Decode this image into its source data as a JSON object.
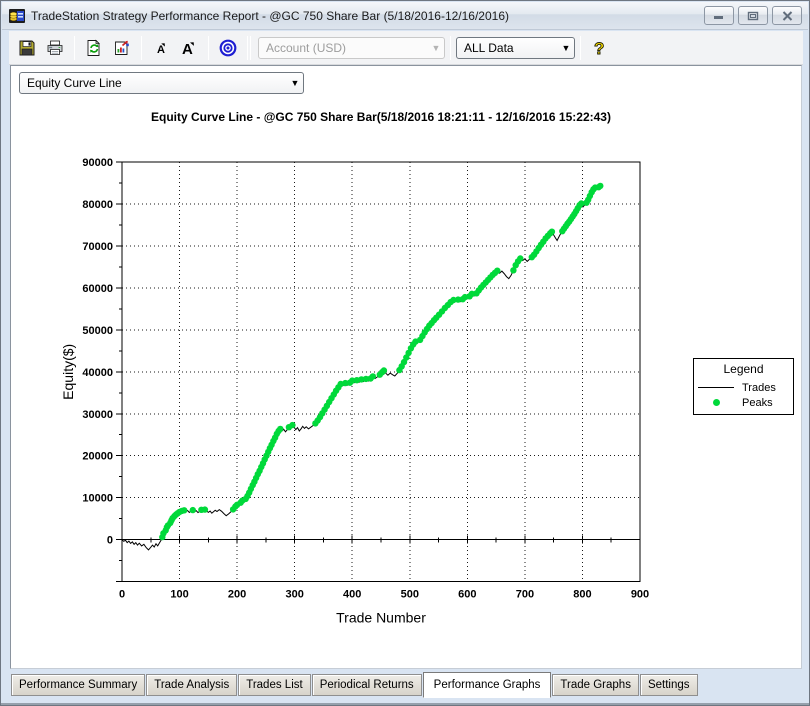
{
  "window": {
    "title": "TradeStation Strategy Performance Report - @GC 750 Share Bar (5/18/2016-12/16/2016)"
  },
  "toolbar": {
    "buttons": [
      "save",
      "print",
      "refresh-report",
      "export-report",
      "font-decrease",
      "font-increase",
      "target"
    ],
    "account_combo": {
      "value": "Account (USD)",
      "disabled": true
    },
    "data_combo": {
      "value": "ALL Data",
      "disabled": false
    },
    "help": "help"
  },
  "report": {
    "graph_selector": {
      "value": "Equity Curve Line"
    },
    "chart_title": "Equity Curve Line - @GC 750 Share Bar(5/18/2016 18:21:11 - 12/16/2016 15:22:43)"
  },
  "legend": {
    "title": "Legend",
    "entries": [
      {
        "label": "Trades",
        "marker": "line",
        "color": "#000000"
      },
      {
        "label": "Peaks",
        "marker": "dot",
        "color": "#00d93a"
      }
    ]
  },
  "tabs": {
    "active": "Performance Graphs",
    "items": [
      "Performance Summary",
      "Trade Analysis",
      "Trades List",
      "Periodical Returns",
      "Performance Graphs",
      "Trade Graphs",
      "Settings"
    ]
  },
  "chart_data": {
    "type": "line",
    "title": "Equity Curve Line - @GC 750 Share Bar(5/18/2016 18:21:11 - 12/16/2016 15:22:43)",
    "xlabel": "Trade Number",
    "ylabel": "Equity($)",
    "xlim": [
      0,
      900
    ],
    "ylim": [
      -10000,
      90000
    ],
    "xtick_step": 100,
    "ytick_step": 10000,
    "grid": "dotted",
    "legend_position": "right",
    "series": [
      {
        "name": "Trades",
        "type": "line",
        "color": "#000000",
        "points": [
          [
            0,
            0
          ],
          [
            3,
            -400
          ],
          [
            6,
            -150
          ],
          [
            9,
            -700
          ],
          [
            12,
            -350
          ],
          [
            15,
            -900
          ],
          [
            18,
            -550
          ],
          [
            21,
            -1100
          ],
          [
            24,
            -700
          ],
          [
            27,
            -1300
          ],
          [
            30,
            -850
          ],
          [
            34,
            -1500
          ],
          [
            38,
            -1100
          ],
          [
            42,
            -1900
          ],
          [
            46,
            -2450
          ],
          [
            50,
            -1800
          ],
          [
            53,
            -1300
          ],
          [
            56,
            -1750
          ],
          [
            59,
            -1000
          ],
          [
            62,
            -1500
          ],
          [
            65,
            -800
          ],
          [
            68,
            -100
          ],
          [
            70,
            600
          ],
          [
            72,
            1500
          ],
          [
            74,
            1200
          ],
          [
            76,
            2200
          ],
          [
            78,
            3000
          ],
          [
            80,
            3400
          ],
          [
            82,
            3100
          ],
          [
            84,
            4000
          ],
          [
            86,
            4600
          ],
          [
            88,
            5100
          ],
          [
            91,
            5600
          ],
          [
            94,
            6000
          ],
          [
            97,
            6300
          ],
          [
            100,
            6600
          ],
          [
            104,
            6850
          ],
          [
            108,
            7000
          ],
          [
            111,
            6700
          ],
          [
            114,
            6950
          ],
          [
            117,
            6500
          ],
          [
            120,
            6800
          ],
          [
            123,
            7050
          ],
          [
            126,
            6600
          ],
          [
            129,
            6900
          ],
          [
            132,
            6450
          ],
          [
            135,
            6750
          ],
          [
            138,
            7100
          ],
          [
            141,
            6800
          ],
          [
            144,
            7150
          ],
          [
            147,
            6850
          ],
          [
            150,
            6500
          ],
          [
            153,
            6800
          ],
          [
            156,
            6300
          ],
          [
            159,
            6650
          ],
          [
            162,
            7000
          ],
          [
            165,
            6700
          ],
          [
            169,
            7150
          ],
          [
            173,
            6750
          ],
          [
            177,
            6200
          ],
          [
            181,
            5700
          ],
          [
            185,
            6100
          ],
          [
            189,
            6600
          ],
          [
            193,
            7200
          ],
          [
            197,
            7900
          ],
          [
            200,
            8300
          ],
          [
            203,
            8100
          ],
          [
            206,
            8800
          ],
          [
            209,
            9300
          ],
          [
            212,
            9100
          ],
          [
            215,
            9700
          ],
          [
            218,
            10400
          ],
          [
            221,
            11200
          ],
          [
            224,
            12100
          ],
          [
            227,
            13000
          ],
          [
            230,
            13800
          ],
          [
            233,
            14700
          ],
          [
            236,
            15600
          ],
          [
            239,
            16400
          ],
          [
            242,
            17300
          ],
          [
            245,
            18200
          ],
          [
            248,
            19100
          ],
          [
            251,
            20000
          ],
          [
            254,
            20900
          ],
          [
            257,
            21800
          ],
          [
            260,
            22600
          ],
          [
            263,
            23500
          ],
          [
            266,
            24300
          ],
          [
            269,
            25200
          ],
          [
            272,
            25900
          ],
          [
            275,
            26400
          ],
          [
            278,
            25900
          ],
          [
            281,
            26300
          ],
          [
            284,
            25700
          ],
          [
            287,
            26200
          ],
          [
            290,
            26800
          ],
          [
            293,
            26300
          ],
          [
            296,
            27300
          ],
          [
            299,
            26800
          ],
          [
            302,
            26200
          ],
          [
            305,
            26700
          ],
          [
            308,
            25900
          ],
          [
            311,
            26400
          ],
          [
            314,
            27000
          ],
          [
            317,
            26500
          ],
          [
            320,
            26900
          ],
          [
            324,
            26400
          ],
          [
            328,
            26800
          ],
          [
            332,
            27200
          ],
          [
            336,
            27700
          ],
          [
            340,
            28400
          ],
          [
            344,
            29200
          ],
          [
            348,
            30100
          ],
          [
            352,
            31000
          ],
          [
            356,
            31900
          ],
          [
            360,
            32800
          ],
          [
            364,
            33700
          ],
          [
            368,
            34600
          ],
          [
            372,
            35500
          ],
          [
            376,
            36300
          ],
          [
            380,
            37100
          ],
          [
            384,
            36700
          ],
          [
            388,
            37300
          ],
          [
            392,
            36800
          ],
          [
            396,
            37400
          ],
          [
            400,
            37900
          ],
          [
            404,
            37400
          ],
          [
            408,
            38000
          ],
          [
            412,
            37500
          ],
          [
            416,
            38200
          ],
          [
            420,
            37700
          ],
          [
            424,
            38300
          ],
          [
            428,
            37800
          ],
          [
            432,
            38400
          ],
          [
            436,
            38900
          ],
          [
            440,
            38400
          ],
          [
            444,
            38800
          ],
          [
            448,
            39300
          ],
          [
            452,
            39900
          ],
          [
            455,
            40300
          ],
          [
            458,
            39700
          ],
          [
            462,
            39200
          ],
          [
            466,
            39700
          ],
          [
            470,
            39300
          ],
          [
            474,
            39000
          ],
          [
            478,
            39600
          ],
          [
            482,
            40400
          ],
          [
            486,
            41300
          ],
          [
            490,
            42300
          ],
          [
            494,
            43400
          ],
          [
            498,
            44500
          ],
          [
            502,
            45600
          ],
          [
            506,
            46500
          ],
          [
            510,
            47200
          ],
          [
            514,
            46900
          ],
          [
            518,
            47600
          ],
          [
            522,
            48500
          ],
          [
            526,
            49400
          ],
          [
            530,
            50200
          ],
          [
            534,
            51000
          ],
          [
            538,
            51600
          ],
          [
            542,
            52300
          ],
          [
            546,
            52900
          ],
          [
            551,
            53600
          ],
          [
            556,
            54400
          ],
          [
            561,
            55200
          ],
          [
            566,
            55900
          ],
          [
            571,
            56600
          ],
          [
            576,
            57100
          ],
          [
            580,
            56800
          ],
          [
            584,
            57200
          ],
          [
            588,
            56700
          ],
          [
            592,
            57300
          ],
          [
            596,
            57800
          ],
          [
            600,
            57400
          ],
          [
            604,
            58000
          ],
          [
            608,
            58600
          ],
          [
            612,
            58100
          ],
          [
            616,
            58700
          ],
          [
            620,
            59400
          ],
          [
            624,
            60100
          ],
          [
            628,
            60700
          ],
          [
            632,
            61300
          ],
          [
            636,
            61900
          ],
          [
            640,
            62500
          ],
          [
            644,
            63100
          ],
          [
            648,
            63600
          ],
          [
            652,
            64100
          ],
          [
            656,
            63500
          ],
          [
            660,
            64000
          ],
          [
            664,
            63400
          ],
          [
            668,
            62700
          ],
          [
            672,
            62200
          ],
          [
            676,
            63000
          ],
          [
            680,
            64200
          ],
          [
            684,
            65400
          ],
          [
            688,
            66300
          ],
          [
            692,
            67000
          ],
          [
            696,
            66500
          ],
          [
            700,
            66900
          ],
          [
            704,
            66300
          ],
          [
            708,
            66800
          ],
          [
            712,
            67300
          ],
          [
            716,
            67900
          ],
          [
            720,
            68700
          ],
          [
            724,
            69500
          ],
          [
            728,
            70300
          ],
          [
            732,
            71000
          ],
          [
            736,
            71800
          ],
          [
            740,
            72400
          ],
          [
            744,
            73000
          ],
          [
            747,
            73400
          ],
          [
            750,
            72600
          ],
          [
            753,
            71900
          ],
          [
            756,
            71300
          ],
          [
            759,
            72100
          ],
          [
            762,
            72900
          ],
          [
            765,
            73500
          ],
          [
            768,
            74100
          ],
          [
            771,
            74700
          ],
          [
            774,
            75300
          ],
          [
            777,
            75800
          ],
          [
            780,
            76400
          ],
          [
            783,
            77000
          ],
          [
            786,
            77600
          ],
          [
            789,
            78300
          ],
          [
            792,
            79000
          ],
          [
            795,
            79700
          ],
          [
            798,
            80100
          ],
          [
            801,
            79300
          ],
          [
            804,
            79800
          ],
          [
            807,
            80300
          ],
          [
            810,
            81000
          ],
          [
            813,
            81900
          ],
          [
            816,
            82800
          ],
          [
            819,
            83500
          ],
          [
            822,
            83900
          ],
          [
            825,
            83600
          ],
          [
            828,
            84000
          ],
          [
            831,
            84300
          ],
          [
            834,
            84100
          ]
        ]
      },
      {
        "name": "Peaks",
        "type": "scatter",
        "color": "#00d93a",
        "derived": "points of the Trades series that set a new running equity high"
      }
    ]
  }
}
